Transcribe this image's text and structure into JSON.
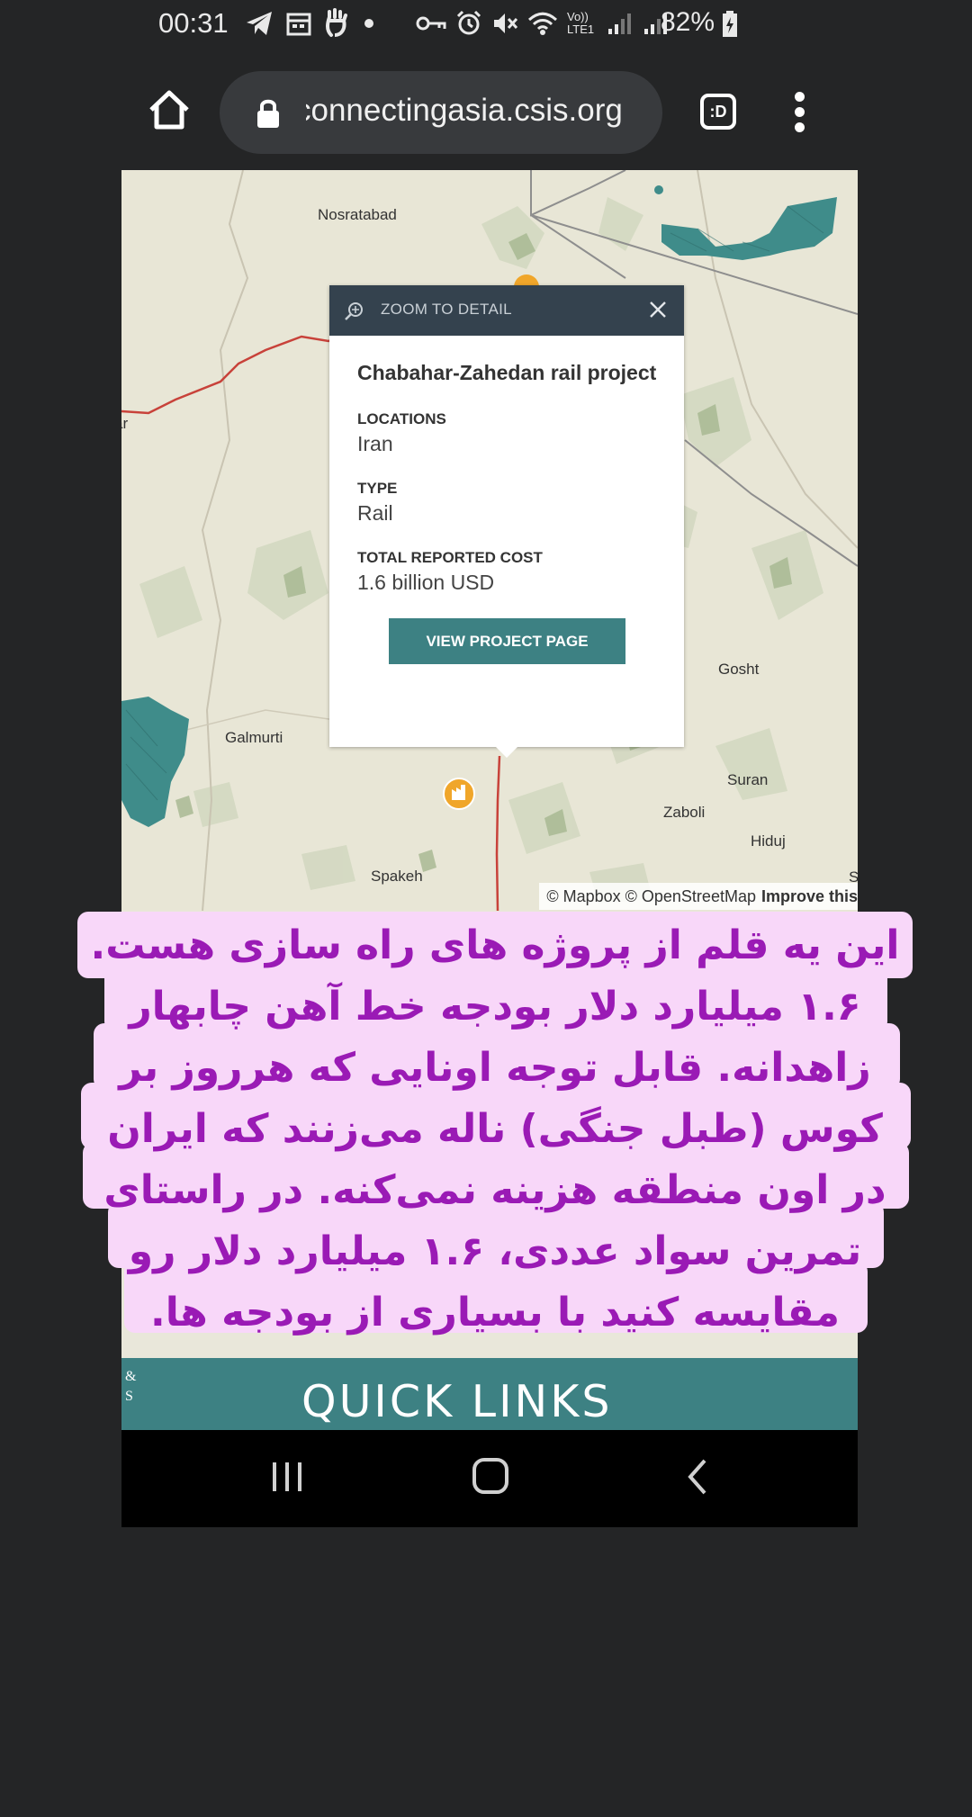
{
  "status_bar": {
    "time": "00:31",
    "network": "Vo)) LTE1",
    "battery": "82%"
  },
  "browser": {
    "url": "connectingasia.csis.org",
    "tabs_label": ":D"
  },
  "map": {
    "places": [
      "Nosratabad",
      "Gosht",
      "Galmurti",
      "Suran",
      "Zaboli",
      "Hiduj",
      "Spakeh",
      "ar",
      "S"
    ],
    "attribution": "© Mapbox © OpenStreetMap",
    "attribution_link": "Improve this"
  },
  "popup": {
    "header": "ZOOM TO DETAIL",
    "title": "Chabahar-Zahedan rail project",
    "locations_label": "LOCATIONS",
    "locations_value": "Iran",
    "type_label": "TYPE",
    "type_value": "Rail",
    "cost_label": "TOTAL REPORTED COST",
    "cost_value": "1.6 billion USD",
    "button": "VIEW PROJECT PAGE"
  },
  "quick_links": {
    "label": "QUICK LINKS",
    "side": "& S"
  },
  "overlay_caption": {
    "lines": [
      "این یه قلم از پروژه های راه سازی هست.",
      "۱.۶ میلیارد دلار بودجه خط آهن چابهار",
      "زاهدانه. قابل توجه اونایی که هرروز بر",
      "کوس (طبل جنگی) ناله می‌زنند که ایران",
      "در اون منطقه هزینه نمی‌کنه. در راستای",
      "تمرین سواد عددی، ۱.۶ میلیارد دلار رو",
      "مقایسه کنید با بسیاری از بودجه ها."
    ]
  },
  "colors": {
    "accent": "#3d8183",
    "caption_text": "#9a1ab5",
    "caption_bg": "#f8d7f9",
    "popup_header": "#34424e"
  }
}
